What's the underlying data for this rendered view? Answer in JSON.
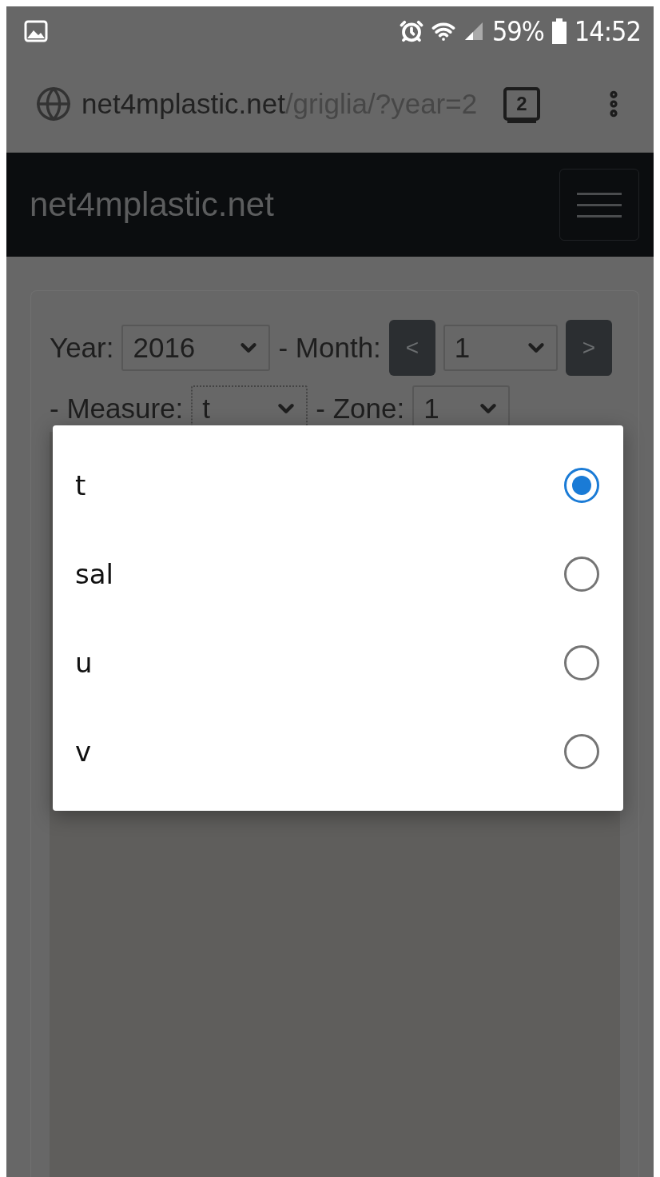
{
  "status_bar": {
    "battery": "59%",
    "time": "14:52"
  },
  "browser": {
    "url_host": "net4mplastic.net",
    "url_path": "/griglia/?year=2",
    "tab_count": "2"
  },
  "navbar": {
    "brand": "net4mplastic.net"
  },
  "form": {
    "year_label": "Year:",
    "year": "2016",
    "month_label": "- Month:",
    "prev": "<",
    "month": "1",
    "next": ">",
    "measure_label": "- Measure:",
    "measure": "t",
    "zone_label": "- Zone:",
    "zone": "1"
  },
  "dialog": {
    "options": [
      {
        "label": "t",
        "selected": true
      },
      {
        "label": "sal",
        "selected": false
      },
      {
        "label": "u",
        "selected": false
      },
      {
        "label": "v",
        "selected": false
      }
    ]
  }
}
